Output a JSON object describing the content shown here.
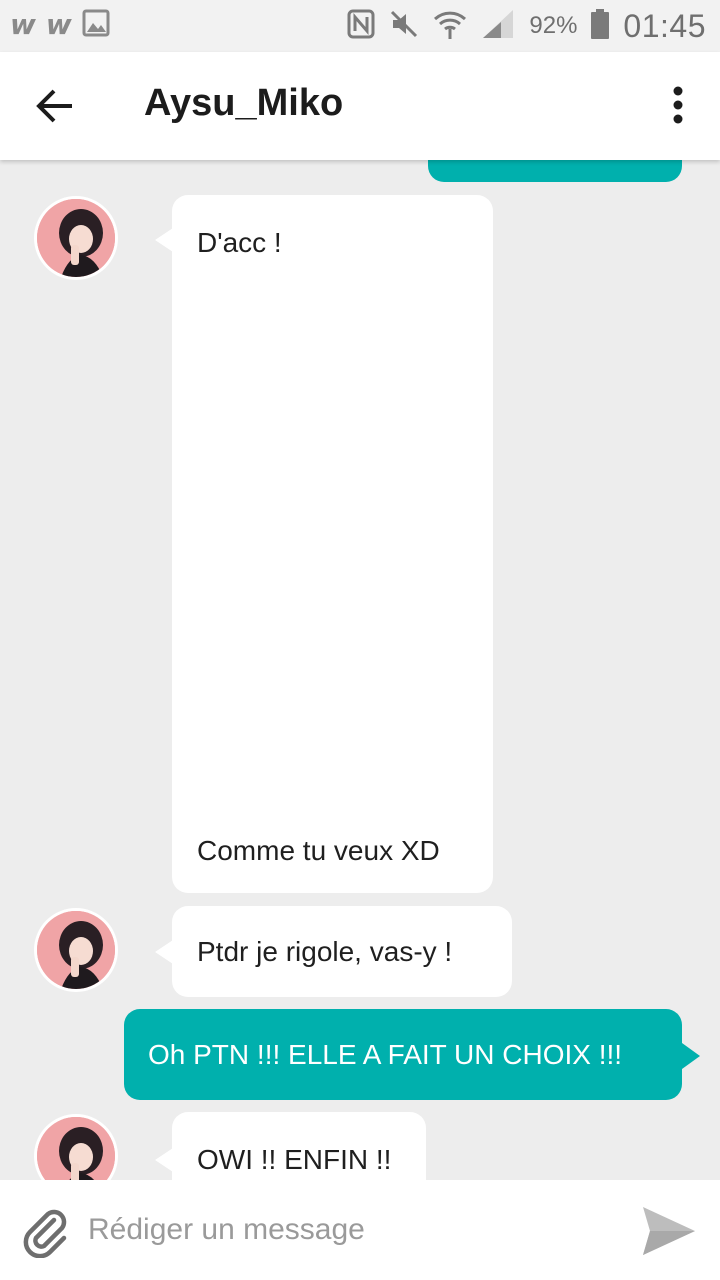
{
  "status_bar": {
    "app_icons": [
      "w",
      "w"
    ],
    "battery_percent": "92%",
    "time": "01:45"
  },
  "header": {
    "title": "Aysu_Miko"
  },
  "messages": [
    {
      "direction": "incoming",
      "text_lines": [
        "D'acc !",
        "Comme tu veux XD"
      ]
    },
    {
      "direction": "incoming",
      "text": "Ptdr je rigole, vas-y !"
    },
    {
      "direction": "outgoing",
      "text": "Oh PTN !!! ELLE A FAIT UN CHOIX !!!"
    },
    {
      "direction": "incoming",
      "text": "OWI !! ENFIN !!"
    }
  ],
  "composer": {
    "placeholder": "Rédiger un message"
  },
  "colors": {
    "accent": "#00b0ad",
    "background": "#ededed",
    "bubble_incoming": "#ffffff"
  }
}
